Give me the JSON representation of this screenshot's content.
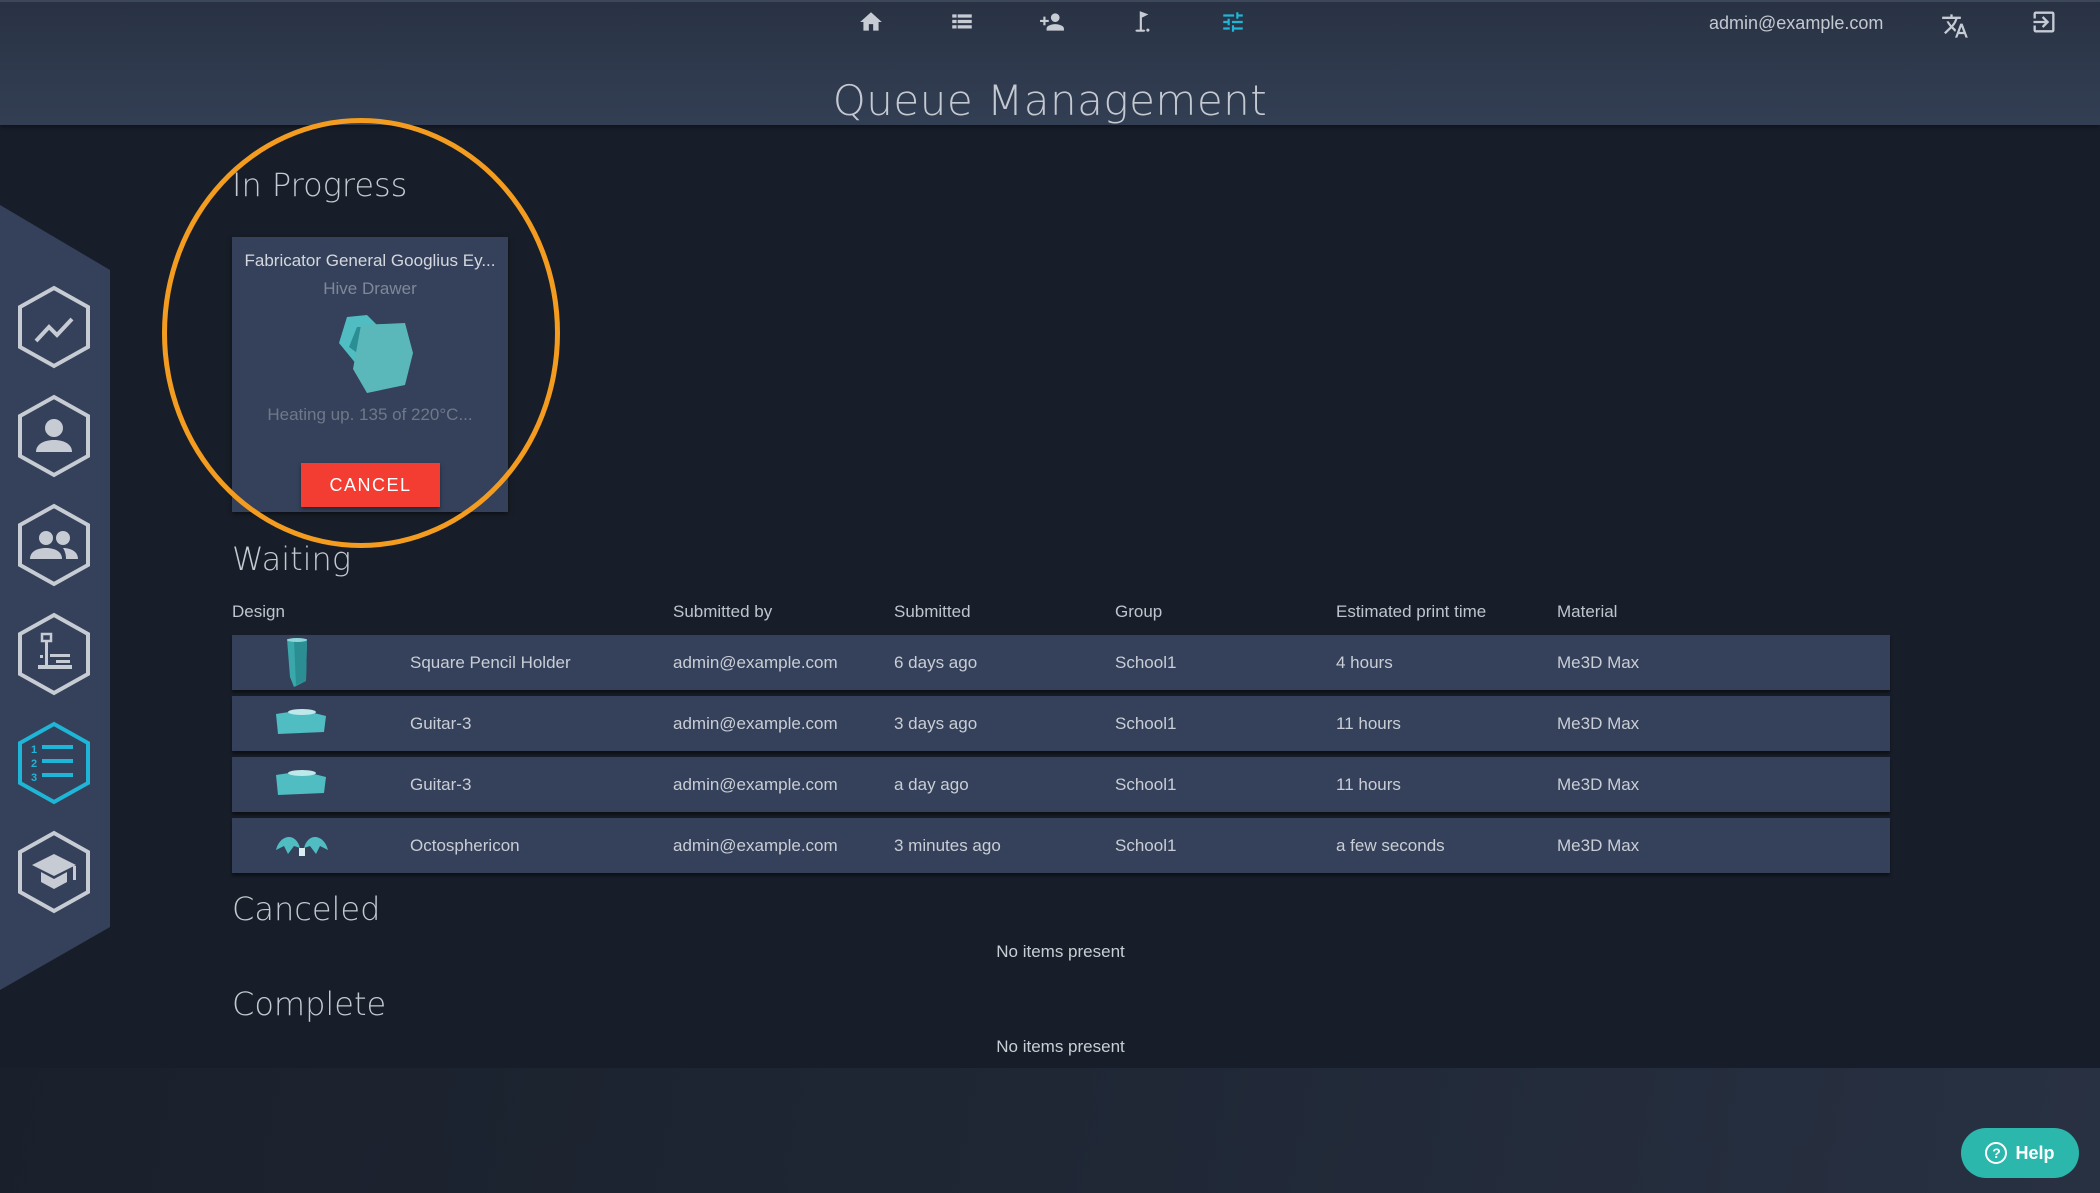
{
  "header": {
    "title": "Queue Management",
    "user_email": "admin@example.com",
    "nav": [
      {
        "icon": "home-icon",
        "label": "Home",
        "active": false
      },
      {
        "icon": "list-icon",
        "label": "List",
        "active": false
      },
      {
        "icon": "add-user-icon",
        "label": "Add user",
        "active": false
      },
      {
        "icon": "golf-flag-icon",
        "label": "Flag",
        "active": false
      },
      {
        "icon": "sliders-icon",
        "label": "Settings",
        "active": true
      }
    ],
    "translate_icon": "translate-icon",
    "logout_icon": "logout-icon"
  },
  "sidebar": {
    "items": [
      {
        "icon": "analytics-icon",
        "label": "Analytics",
        "active": false
      },
      {
        "icon": "user-icon",
        "label": "User",
        "active": false
      },
      {
        "icon": "group-icon",
        "label": "Groups",
        "active": false
      },
      {
        "icon": "printer-icon",
        "label": "Printers",
        "active": false
      },
      {
        "icon": "queue-list-icon",
        "label": "Queue",
        "active": true
      },
      {
        "icon": "education-icon",
        "label": "Education",
        "active": false
      }
    ]
  },
  "in_progress": {
    "title": "In Progress",
    "card": {
      "printer": "Fabricator General Googlius Ey...",
      "design": "Hive Drawer",
      "status": "Heating up. 135 of 220°C...",
      "cancel_label": "CANCEL"
    }
  },
  "waiting": {
    "title": "Waiting",
    "columns": [
      "Design",
      "Submitted by",
      "Submitted",
      "Group",
      "Estimated print time",
      "Material"
    ],
    "rows": [
      {
        "design": "Square Pencil Holder",
        "thumb": "pencil-holder",
        "submitted_by": "admin@example.com",
        "submitted": "6 days ago",
        "group": "School1",
        "print_time": "4 hours",
        "material": "Me3D Max"
      },
      {
        "design": "Guitar-3",
        "thumb": "guitar",
        "submitted_by": "admin@example.com",
        "submitted": "3 days ago",
        "group": "School1",
        "print_time": "11 hours",
        "material": "Me3D Max"
      },
      {
        "design": "Guitar-3",
        "thumb": "guitar",
        "submitted_by": "admin@example.com",
        "submitted": "a day ago",
        "group": "School1",
        "print_time": "11 hours",
        "material": "Me3D Max"
      },
      {
        "design": "Octosphericon",
        "thumb": "octosphericon",
        "submitted_by": "admin@example.com",
        "submitted": "3 minutes ago",
        "group": "School1",
        "print_time": "a few seconds",
        "material": "Me3D Max"
      }
    ]
  },
  "canceled": {
    "title": "Canceled",
    "empty": "No items present"
  },
  "complete": {
    "title": "Complete",
    "empty": "No items present"
  },
  "help": {
    "label": "Help",
    "icon": "?"
  },
  "colors": {
    "accent": "#1fb5d6",
    "cancel": "#f33d32",
    "help": "#2bb7ac",
    "highlight": "#f39c1f",
    "row": "#35415a",
    "background": "#181e29"
  }
}
